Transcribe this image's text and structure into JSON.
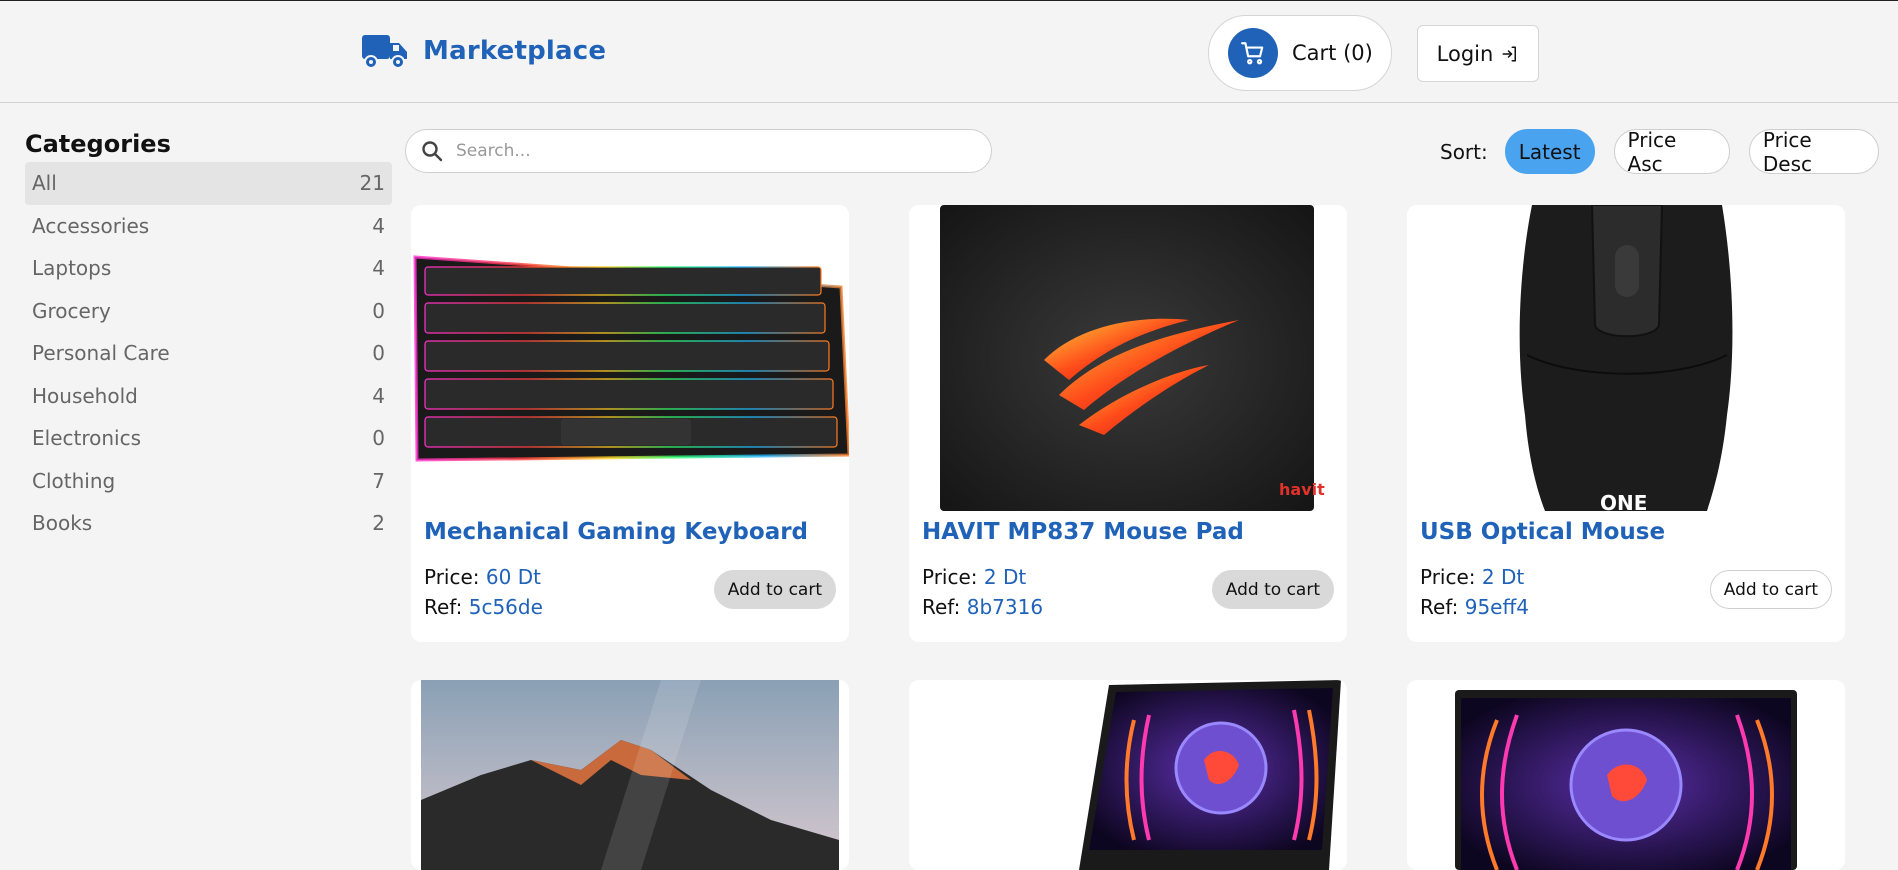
{
  "header": {
    "brand": "Marketplace",
    "cart_label": "Cart (0)",
    "login_label": "Login"
  },
  "sidebar": {
    "title": "Categories",
    "items": [
      {
        "label": "All",
        "count": "21"
      },
      {
        "label": "Accessories",
        "count": "4"
      },
      {
        "label": "Laptops",
        "count": "4"
      },
      {
        "label": "Grocery",
        "count": "0"
      },
      {
        "label": "Personal Care",
        "count": "0"
      },
      {
        "label": "Household",
        "count": "4"
      },
      {
        "label": "Electronics",
        "count": "0"
      },
      {
        "label": "Clothing",
        "count": "7"
      },
      {
        "label": "Books",
        "count": "2"
      }
    ]
  },
  "search": {
    "placeholder": "Search...",
    "value": ""
  },
  "sort": {
    "label": "Sort:",
    "options": [
      "Latest",
      "Price Asc",
      "Price Desc"
    ],
    "selected": "Latest"
  },
  "products": [
    {
      "title": "Mechanical Gaming Keyboard",
      "price_label": "Price:",
      "price": "60 Dt",
      "ref_label": "Ref:",
      "ref": "5c56de",
      "button": "Add to cart",
      "image": "keyboard"
    },
    {
      "title": "HAVIT MP837 Mouse Pad",
      "price_label": "Price:",
      "price": "2 Dt",
      "ref_label": "Ref:",
      "ref": "8b7316",
      "button": "Add to cart",
      "image": "mousepad",
      "pad_brand": "havit"
    },
    {
      "title": "USB Optical Mouse",
      "price_label": "Price:",
      "price": "2 Dt",
      "ref_label": "Ref:",
      "ref": "95eff4",
      "button": "Add to cart",
      "image": "mouse",
      "mouse_brand": "ONE"
    },
    {
      "image": "monitor-mountains"
    },
    {
      "image": "laptop-dragon"
    },
    {
      "image": "laptop-dragon-front"
    }
  ],
  "colors": {
    "brand": "#1f62b8",
    "sort_active": "#4aa3ef",
    "background": "#f4f4f4"
  }
}
